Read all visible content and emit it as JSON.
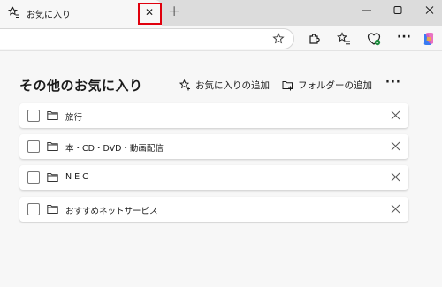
{
  "tab": {
    "title": "お気に入り",
    "close_glyph": "✕",
    "new_tab_glyph": "+"
  },
  "page": {
    "title": "その他のお気に入り",
    "add_favorite": "お気に入りの追加",
    "add_folder": "フォルダーの追加",
    "more": "···"
  },
  "folders": [
    {
      "label": "旅行"
    },
    {
      "label": "本・CD・DVD・動画配信"
    },
    {
      "label": "N E C"
    },
    {
      "label": "おすすめネットサービス"
    }
  ],
  "colors": {
    "highlight": "#e0000d",
    "tab_strip": "#dcdcdc",
    "page_bg": "#f7f7f7"
  }
}
